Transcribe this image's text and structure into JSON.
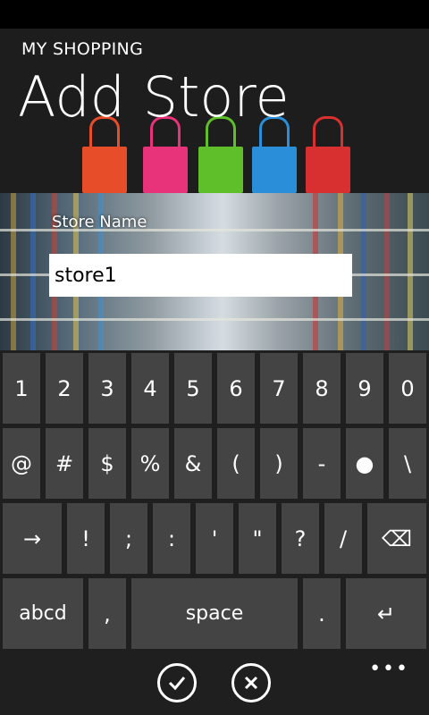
{
  "header": {
    "app_title": "MY SHOPPING",
    "page_title": "Add Store"
  },
  "form": {
    "store_name_label": "Store Name",
    "store_name_value": "store1"
  },
  "keyboard": {
    "row1": [
      "1",
      "2",
      "3",
      "4",
      "5",
      "6",
      "7",
      "8",
      "9",
      "0"
    ],
    "row2": [
      "@",
      "#",
      "$",
      "%",
      "&",
      "(",
      ")",
      "-",
      "●",
      "\\"
    ],
    "row3": [
      "→",
      "!",
      ";",
      ":",
      "'",
      "\"",
      "?",
      "/",
      "⌫"
    ],
    "row4": [
      "abcd",
      ",",
      "space",
      ".",
      "↵"
    ]
  },
  "appbar": {
    "more": "•••"
  },
  "colors": {
    "accent": "#ffffff",
    "key_bg": "#444444",
    "keyboard_bg": "#1f1f1f",
    "bags": [
      "#e84d2a",
      "#e8327a",
      "#5fbf2a",
      "#2a8fd8",
      "#d83030"
    ]
  }
}
